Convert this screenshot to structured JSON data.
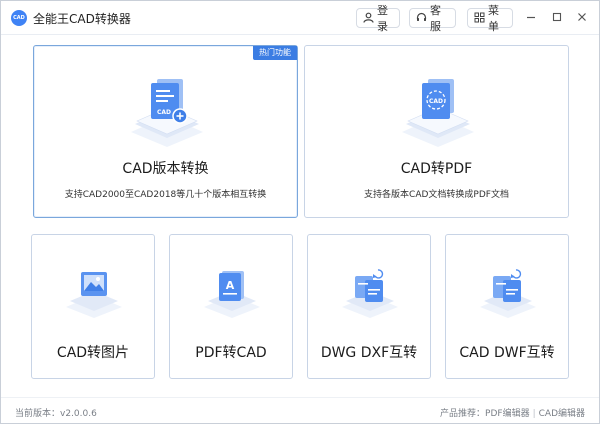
{
  "app": {
    "logo_text": "CAD",
    "title": "全能王CAD转换器"
  },
  "toolbar": {
    "login_label": "登录",
    "service_label": "客服",
    "menu_label": "菜单"
  },
  "cards": {
    "version_convert": {
      "title": "CAD版本转换",
      "desc": "支持CAD2000至CAD2018等几十个版本相互转换",
      "badge": "热门功能",
      "icon_text": "CAD"
    },
    "to_pdf": {
      "title": "CAD转PDF",
      "desc": "支持各版本CAD文档转换成PDF文档",
      "icon_text": "CAD"
    },
    "to_image": {
      "title": "CAD转图片"
    },
    "pdf_to_cad": {
      "title": "PDF转CAD",
      "icon_text": "A"
    },
    "dwg_dxf": {
      "title": "DWG DXF互转"
    },
    "cad_dwf": {
      "title": "CAD DWF互转"
    }
  },
  "footer": {
    "version_label": "当前版本：",
    "version_value": "v2.0.0.6",
    "recommend_label": "产品推荐：",
    "link_pdf_editor": "PDF编辑器",
    "separator": "|",
    "link_cad_editor": "CAD编辑器"
  },
  "colors": {
    "accent": "#3b7de3",
    "card_border": "#c8d4e6",
    "icon_blue": "#5a93f0",
    "icon_light": "#e3ecfb"
  }
}
